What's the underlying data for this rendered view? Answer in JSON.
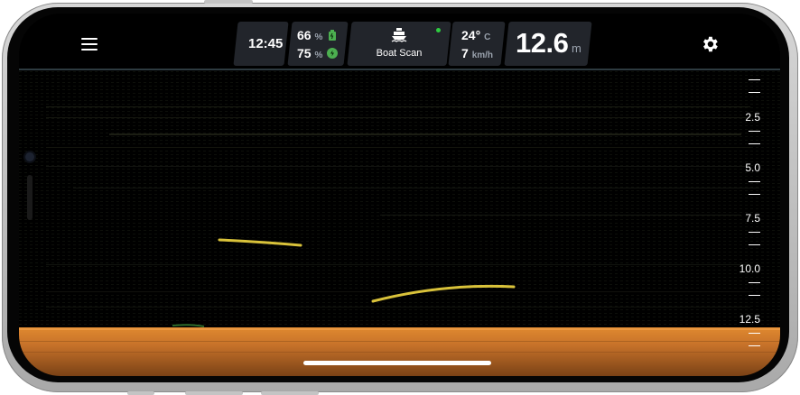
{
  "topbar": {
    "time": "12:45",
    "battery_percent": "66",
    "battery_unit": "%",
    "device_battery_percent": "75",
    "device_battery_unit": "%",
    "mode_label": "Boat Scan",
    "temperature": "24°",
    "temperature_unit": "C",
    "speed": "7",
    "speed_unit": "km/h",
    "depth": "12.6",
    "depth_unit": "m"
  },
  "depth_scale": {
    "labels": [
      "2.5",
      "5.0",
      "7.5",
      "10.0",
      "12.5"
    ]
  },
  "colors": {
    "panel": "#22252b",
    "battery_green": "#4caf50",
    "status_dot": "#2ecc40",
    "seabed": "#c8732a",
    "fish_arc": "#d9c23a"
  },
  "icons": {
    "menu": "hamburger-icon",
    "settings": "gear-icon",
    "battery": "battery-icon",
    "device_battery": "shield-battery-icon",
    "boat": "boat-icon"
  }
}
